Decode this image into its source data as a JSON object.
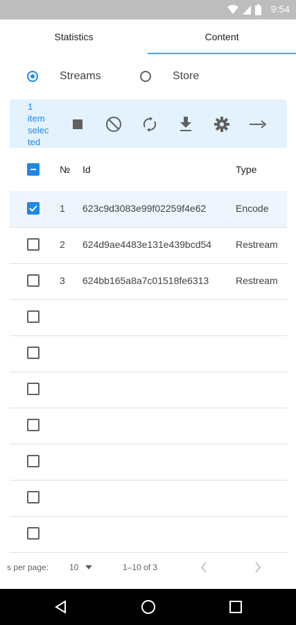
{
  "status_bar": {
    "time": "9:54",
    "icons": [
      "wifi-icon",
      "signal-icon",
      "battery-icon"
    ]
  },
  "tabs": [
    {
      "label": "Statistics",
      "active": false
    },
    {
      "label": "Content",
      "active": true
    }
  ],
  "radios": [
    {
      "label": "Streams",
      "checked": true
    },
    {
      "label": "Store",
      "checked": false
    }
  ],
  "toolbar": {
    "selection_lines": [
      "1",
      "item",
      "selec",
      "ted"
    ],
    "buttons": [
      "stop-icon",
      "block-icon",
      "sync-icon",
      "download-icon",
      "settings-icon",
      "arrow-right-icon"
    ]
  },
  "table": {
    "headers": {
      "no": "№",
      "id": "Id",
      "type": "Type"
    },
    "rows": [
      {
        "no": "1",
        "id": "623c9d3083e99f02259f4e62",
        "type": "Encode",
        "checked": true
      },
      {
        "no": "2",
        "id": "624d9ae4483e131e439bcd54",
        "type": "Restream",
        "checked": false
      },
      {
        "no": "3",
        "id": "624bb165a8a7c01518fe6313",
        "type": "Restream",
        "checked": false
      },
      {
        "no": "",
        "id": "",
        "type": "",
        "checked": false
      },
      {
        "no": "",
        "id": "",
        "type": "",
        "checked": false
      },
      {
        "no": "",
        "id": "",
        "type": "",
        "checked": false
      },
      {
        "no": "",
        "id": "",
        "type": "",
        "checked": false
      },
      {
        "no": "",
        "id": "",
        "type": "",
        "checked": false
      },
      {
        "no": "",
        "id": "",
        "type": "",
        "checked": false
      },
      {
        "no": "",
        "id": "",
        "type": "",
        "checked": false
      }
    ]
  },
  "pagination": {
    "rows_per_page_label": "s per page:",
    "rows_per_page_value": "10",
    "range": "1–10 of 3"
  },
  "colors": {
    "accent": "#1e88e5",
    "selected_bg": "#e3f2fd",
    "status_bar": "#bdbdbd"
  }
}
